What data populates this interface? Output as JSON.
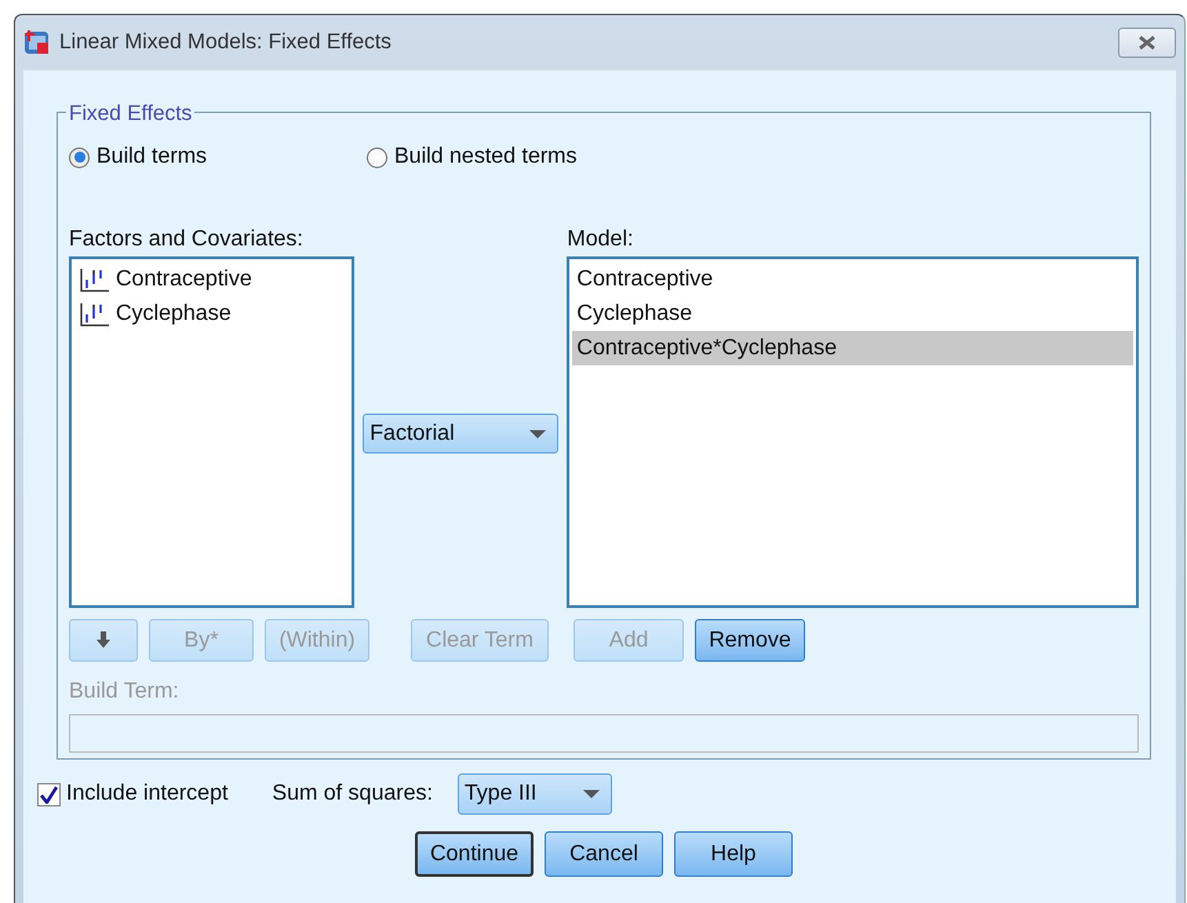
{
  "window": {
    "title": "Linear Mixed Models: Fixed Effects"
  },
  "fixed_effects": {
    "legend": "Fixed Effects",
    "radios": [
      {
        "label": "Build terms",
        "selected": true
      },
      {
        "label": "Build nested terms",
        "selected": false
      }
    ],
    "factors": {
      "label": "Factors and Covariates:",
      "items": [
        {
          "name": "Contraceptive"
        },
        {
          "name": "Cyclephase"
        }
      ]
    },
    "build_dropdown": {
      "value": "Factorial"
    },
    "model": {
      "label": "Model:",
      "items": [
        {
          "name": "Contraceptive",
          "selected": false
        },
        {
          "name": "Cyclephase",
          "selected": false
        },
        {
          "name": "Contraceptive*Cyclephase",
          "selected": true
        }
      ]
    },
    "term_buttons": [
      {
        "kind": "arrow",
        "disabled": true
      },
      {
        "kind": "text",
        "label": "By*",
        "disabled": true
      },
      {
        "kind": "text",
        "label": "(Within)",
        "disabled": true
      },
      {
        "kind": "text",
        "label": "Clear Term",
        "disabled": true
      }
    ],
    "model_buttons": [
      {
        "label": "Add",
        "disabled": true
      },
      {
        "label": "Remove",
        "disabled": false
      }
    ],
    "build_term": {
      "label": "Build Term:",
      "disabled": true
    }
  },
  "intercept": {
    "label": "Include intercept",
    "checked": true
  },
  "sum_of_squares": {
    "label": "Sum of squares:",
    "value": "Type III"
  },
  "buttons": [
    {
      "label": "Continue",
      "default": true
    },
    {
      "label": "Cancel",
      "default": false
    },
    {
      "label": "Help",
      "default": false
    }
  ]
}
